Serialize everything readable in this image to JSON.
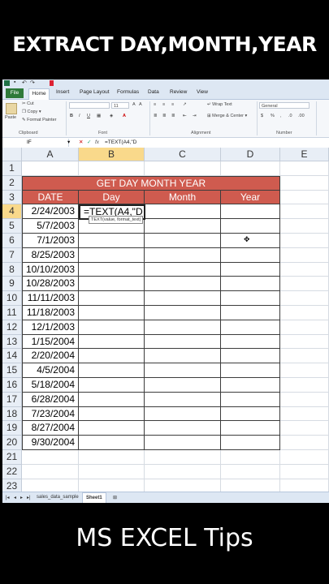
{
  "banner_top": "EXTRACT DAY,MONTH,YEAR",
  "banner_bottom": "MS EXCEL Tips",
  "ribbon_tabs": [
    "File",
    "Home",
    "Insert",
    "Page Layout",
    "Formulas",
    "Data",
    "Review",
    "View"
  ],
  "ribbon": {
    "paste": "Paste",
    "cut": "Cut",
    "copy": "Copy",
    "format_painter": "Format Painter",
    "clipboard": "Clipboard",
    "font_size": "11",
    "font_group": "Font",
    "wrap_text": "Wrap Text",
    "merge_center": "Merge & Center",
    "alignment": "Alignment",
    "number_format": "General",
    "number_group": "Number"
  },
  "formula_bar": {
    "name_box": "IF",
    "fx": "fx",
    "formula": "=TEXT(A4,\"D"
  },
  "columns": [
    "A",
    "B",
    "C",
    "D",
    "E"
  ],
  "rows": [
    "1",
    "2",
    "3",
    "4",
    "5",
    "6",
    "7",
    "8",
    "9",
    "10",
    "11",
    "12",
    "13",
    "14",
    "15",
    "16",
    "17",
    "18",
    "19",
    "20",
    "21",
    "22",
    "23"
  ],
  "table": {
    "title": "GET DAY MONTH YEAR",
    "headers": [
      "DATE",
      "Day",
      "Month",
      "Year"
    ],
    "dates": [
      "2/24/2003",
      "5/7/2003",
      "7/1/2003",
      "8/25/2003",
      "10/10/2003",
      "10/28/2003",
      "11/11/2003",
      "11/18/2003",
      "12/1/2003",
      "1/15/2004",
      "2/20/2004",
      "4/5/2004",
      "5/18/2004",
      "6/28/2004",
      "7/23/2004",
      "8/27/2004",
      "9/30/2004"
    ]
  },
  "active_cell_text": "=TEXT(A4,\"D",
  "tooltip": "TEXT(value, format_text)",
  "sheets": [
    "sales_data_sample",
    "Sheet1"
  ]
}
